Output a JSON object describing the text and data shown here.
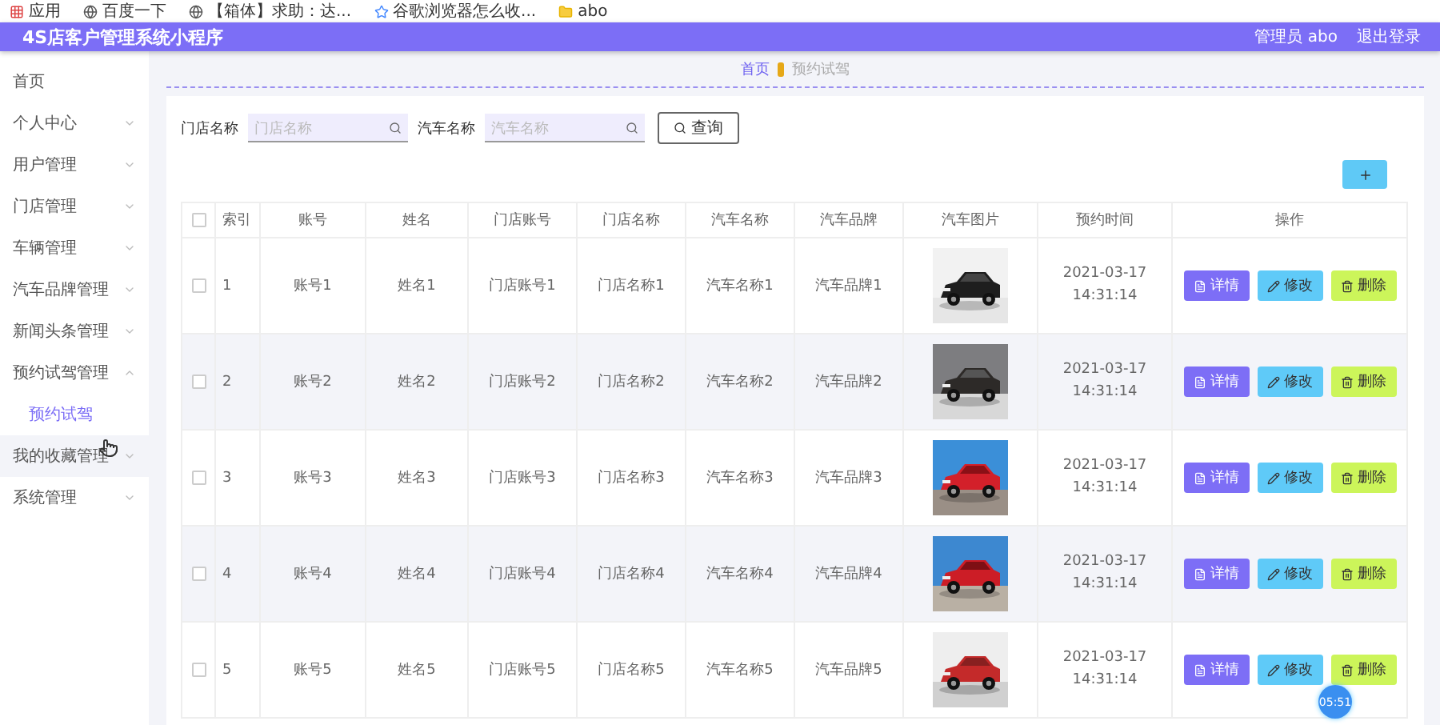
{
  "bookmarks": [
    {
      "kind": "apps",
      "label": "应用"
    },
    {
      "kind": "globe",
      "label": "百度一下"
    },
    {
      "kind": "globe",
      "label": "【箱体】求助：达..."
    },
    {
      "kind": "star",
      "label": "谷歌浏览器怎么收..."
    },
    {
      "kind": "folder",
      "label": "abo"
    }
  ],
  "header": {
    "title": "4S店客户管理系统小程序",
    "user": "管理员 abo",
    "logout": "退出登录"
  },
  "sidebar": {
    "items": [
      {
        "kind": "link",
        "label": "首页",
        "hovered": false
      },
      {
        "kind": "menu",
        "label": "个人中心",
        "expanded": false,
        "hovered": false
      },
      {
        "kind": "menu",
        "label": "用户管理",
        "expanded": false,
        "hovered": false
      },
      {
        "kind": "menu",
        "label": "门店管理",
        "expanded": false,
        "hovered": false
      },
      {
        "kind": "menu",
        "label": "车辆管理",
        "expanded": false,
        "hovered": false
      },
      {
        "kind": "menu",
        "label": "汽车品牌管理",
        "expanded": false,
        "hovered": false
      },
      {
        "kind": "menu",
        "label": "新闻头条管理",
        "expanded": false,
        "hovered": false
      },
      {
        "kind": "menu",
        "label": "预约试驾管理",
        "expanded": true,
        "hovered": false,
        "children": [
          {
            "label": "预约试驾",
            "selected": true
          }
        ]
      },
      {
        "kind": "menu",
        "label": "我的收藏管理",
        "expanded": false,
        "hovered": true
      },
      {
        "kind": "menu",
        "label": "系统管理",
        "expanded": false,
        "hovered": false
      }
    ]
  },
  "breadcrumb": [
    "首页",
    "预约试驾"
  ],
  "search": {
    "fields": [
      {
        "label": "门店名称",
        "placeholder": "门店名称"
      },
      {
        "label": "汽车名称",
        "placeholder": "汽车名称"
      }
    ],
    "button": "查询"
  },
  "table": {
    "header_checked": false,
    "columns": [
      "索引",
      "账号",
      "姓名",
      "门店账号",
      "门店名称",
      "汽车名称",
      "汽车品牌",
      "汽车图片",
      "预约时间",
      "操作"
    ],
    "rows": [
      {
        "checked": false,
        "cells": [
          "1",
          "账号1",
          "姓名1",
          "门店账号1",
          "门店名称1",
          "汽车名称1",
          "汽车品牌1"
        ],
        "time": "2021-03-17 14:31:14",
        "actions": [
          "详情",
          "修改",
          "删除"
        ]
      },
      {
        "checked": false,
        "cells": [
          "2",
          "账号2",
          "姓名2",
          "门店账号2",
          "门店名称2",
          "汽车名称2",
          "汽车品牌2"
        ],
        "time": "2021-03-17 14:31:14",
        "actions": [
          "详情",
          "修改",
          "删除"
        ]
      },
      {
        "checked": false,
        "cells": [
          "3",
          "账号3",
          "姓名3",
          "门店账号3",
          "门店名称3",
          "汽车名称3",
          "汽车品牌3"
        ],
        "time": "2021-03-17 14:31:14",
        "actions": [
          "详情",
          "修改",
          "删除"
        ]
      },
      {
        "checked": false,
        "cells": [
          "4",
          "账号4",
          "姓名4",
          "门店账号4",
          "门店名称4",
          "汽车名称4",
          "汽车品牌4"
        ],
        "time": "2021-03-17 14:31:14",
        "actions": [
          "详情",
          "修改",
          "删除"
        ]
      },
      {
        "checked": false,
        "cells": [
          "5",
          "账号5",
          "姓名5",
          "门店账号5",
          "门店名称5",
          "汽车名称5",
          "汽车品牌5"
        ],
        "time": "2021-03-17 14:31:14",
        "actions": [
          "详情",
          "修改",
          "删除"
        ]
      }
    ]
  },
  "timer_badge": "05:51"
}
